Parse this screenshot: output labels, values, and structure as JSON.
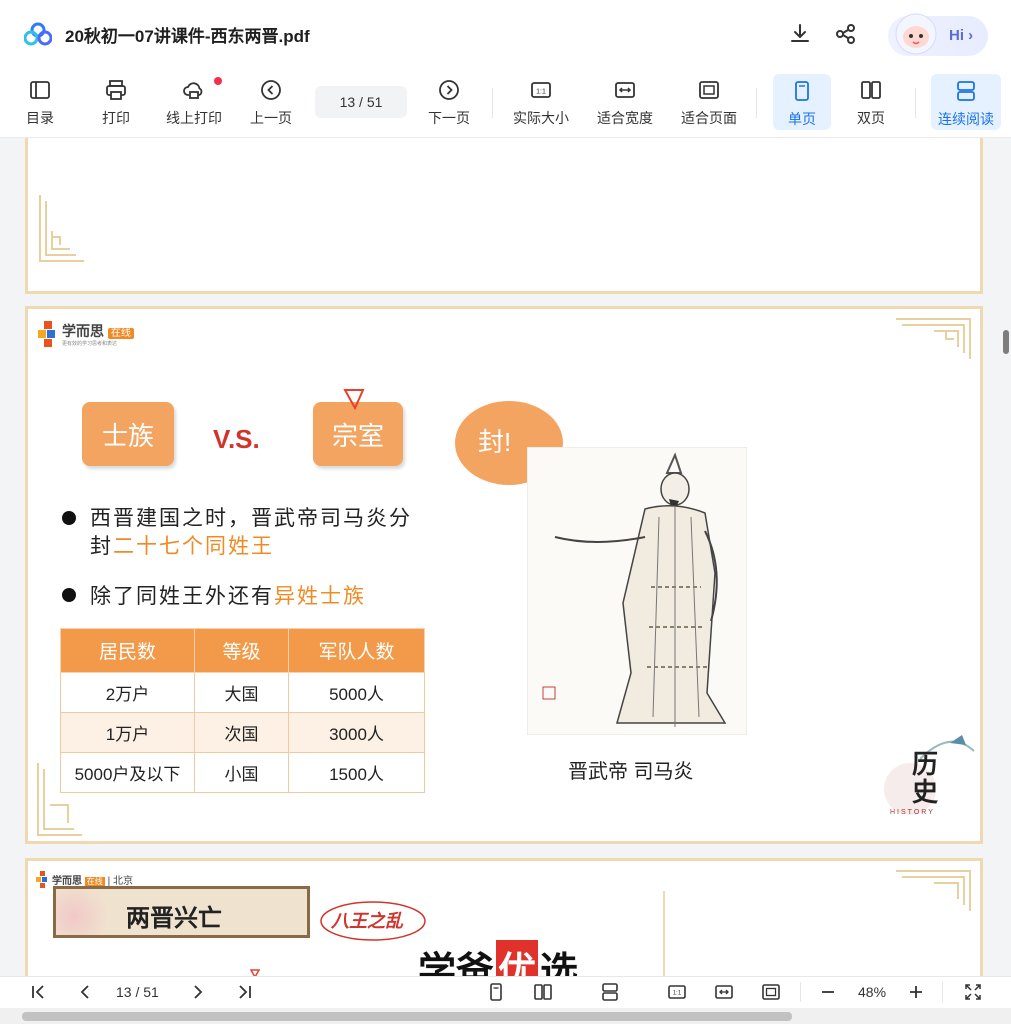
{
  "window": {
    "title": "20秋初一07讲课件-西东两晋.pdf",
    "hi_label": "Hi"
  },
  "toolbar": {
    "toc": "目录",
    "print": "打印",
    "online_print": "线上打印",
    "prev_page": "上一页",
    "page_indicator": "13 / 51",
    "next_page": "下一页",
    "actual_size": "实际大小",
    "fit_width": "适合宽度",
    "fit_page": "适合页面",
    "single_page": "单页",
    "double_page": "双页",
    "continuous": "连续阅读"
  },
  "slide": {
    "brand": "学而思",
    "brand_badge": "在线",
    "brand_tagline": "更有效的学习思考和表达",
    "tag_left": "士族",
    "vs": "V.S.",
    "tag_right": "宗室",
    "speech": "封!",
    "bullet1_part1": "西晋建国之时，晋武帝司马炎分",
    "bullet1_part2a": "封",
    "bullet1_part2b": "二十七个同姓王",
    "bullet2_part1": "除了同姓王外还有",
    "bullet2_part2": "异姓士族",
    "table": {
      "headers": [
        "居民数",
        "等级",
        "军队人数"
      ],
      "rows": [
        [
          "2万户",
          "大国",
          "5000人"
        ],
        [
          "1万户",
          "次国",
          "3000人"
        ],
        [
          "5000户及以下",
          "小国",
          "1500人"
        ]
      ]
    },
    "portrait_caption": "晋武帝 司马炎",
    "history_mark": "历史",
    "history_en": "HISTORY"
  },
  "next_slide": {
    "brand": "学而思",
    "brand_badge": "在线",
    "city": "北京",
    "title": "两晋兴亡",
    "stamp": "八王之乱"
  },
  "watermark": {
    "part1": "学爸",
    "part2": "优",
    "part3": "选"
  },
  "bottombar": {
    "page_indicator": "13 / 51",
    "zoom": "48%"
  },
  "colors": {
    "accent": "#1a73e8",
    "slide_orange": "#f3a461",
    "title_red": "#d0352c"
  }
}
